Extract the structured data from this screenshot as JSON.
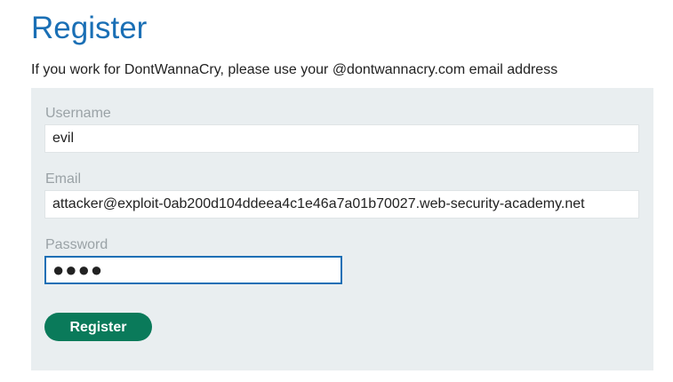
{
  "page": {
    "title": "Register",
    "notice": "If you work for DontWannaCry, please use your @dontwannacry.com email address"
  },
  "form": {
    "username": {
      "label": "Username",
      "value": "evil"
    },
    "email": {
      "label": "Email",
      "value": "attacker@exploit-0ab200d104ddeea4c1e46a7a01b70027.web-security-academy.net"
    },
    "password": {
      "label": "Password",
      "masked_value": "●●●●"
    },
    "submit_label": "Register"
  },
  "colors": {
    "title": "#1a6fb5",
    "panel_background": "#e9eef0",
    "label_text": "#9aa2a6",
    "focus_border": "#1a6fb5",
    "submit_button": "#0a7a5a"
  }
}
